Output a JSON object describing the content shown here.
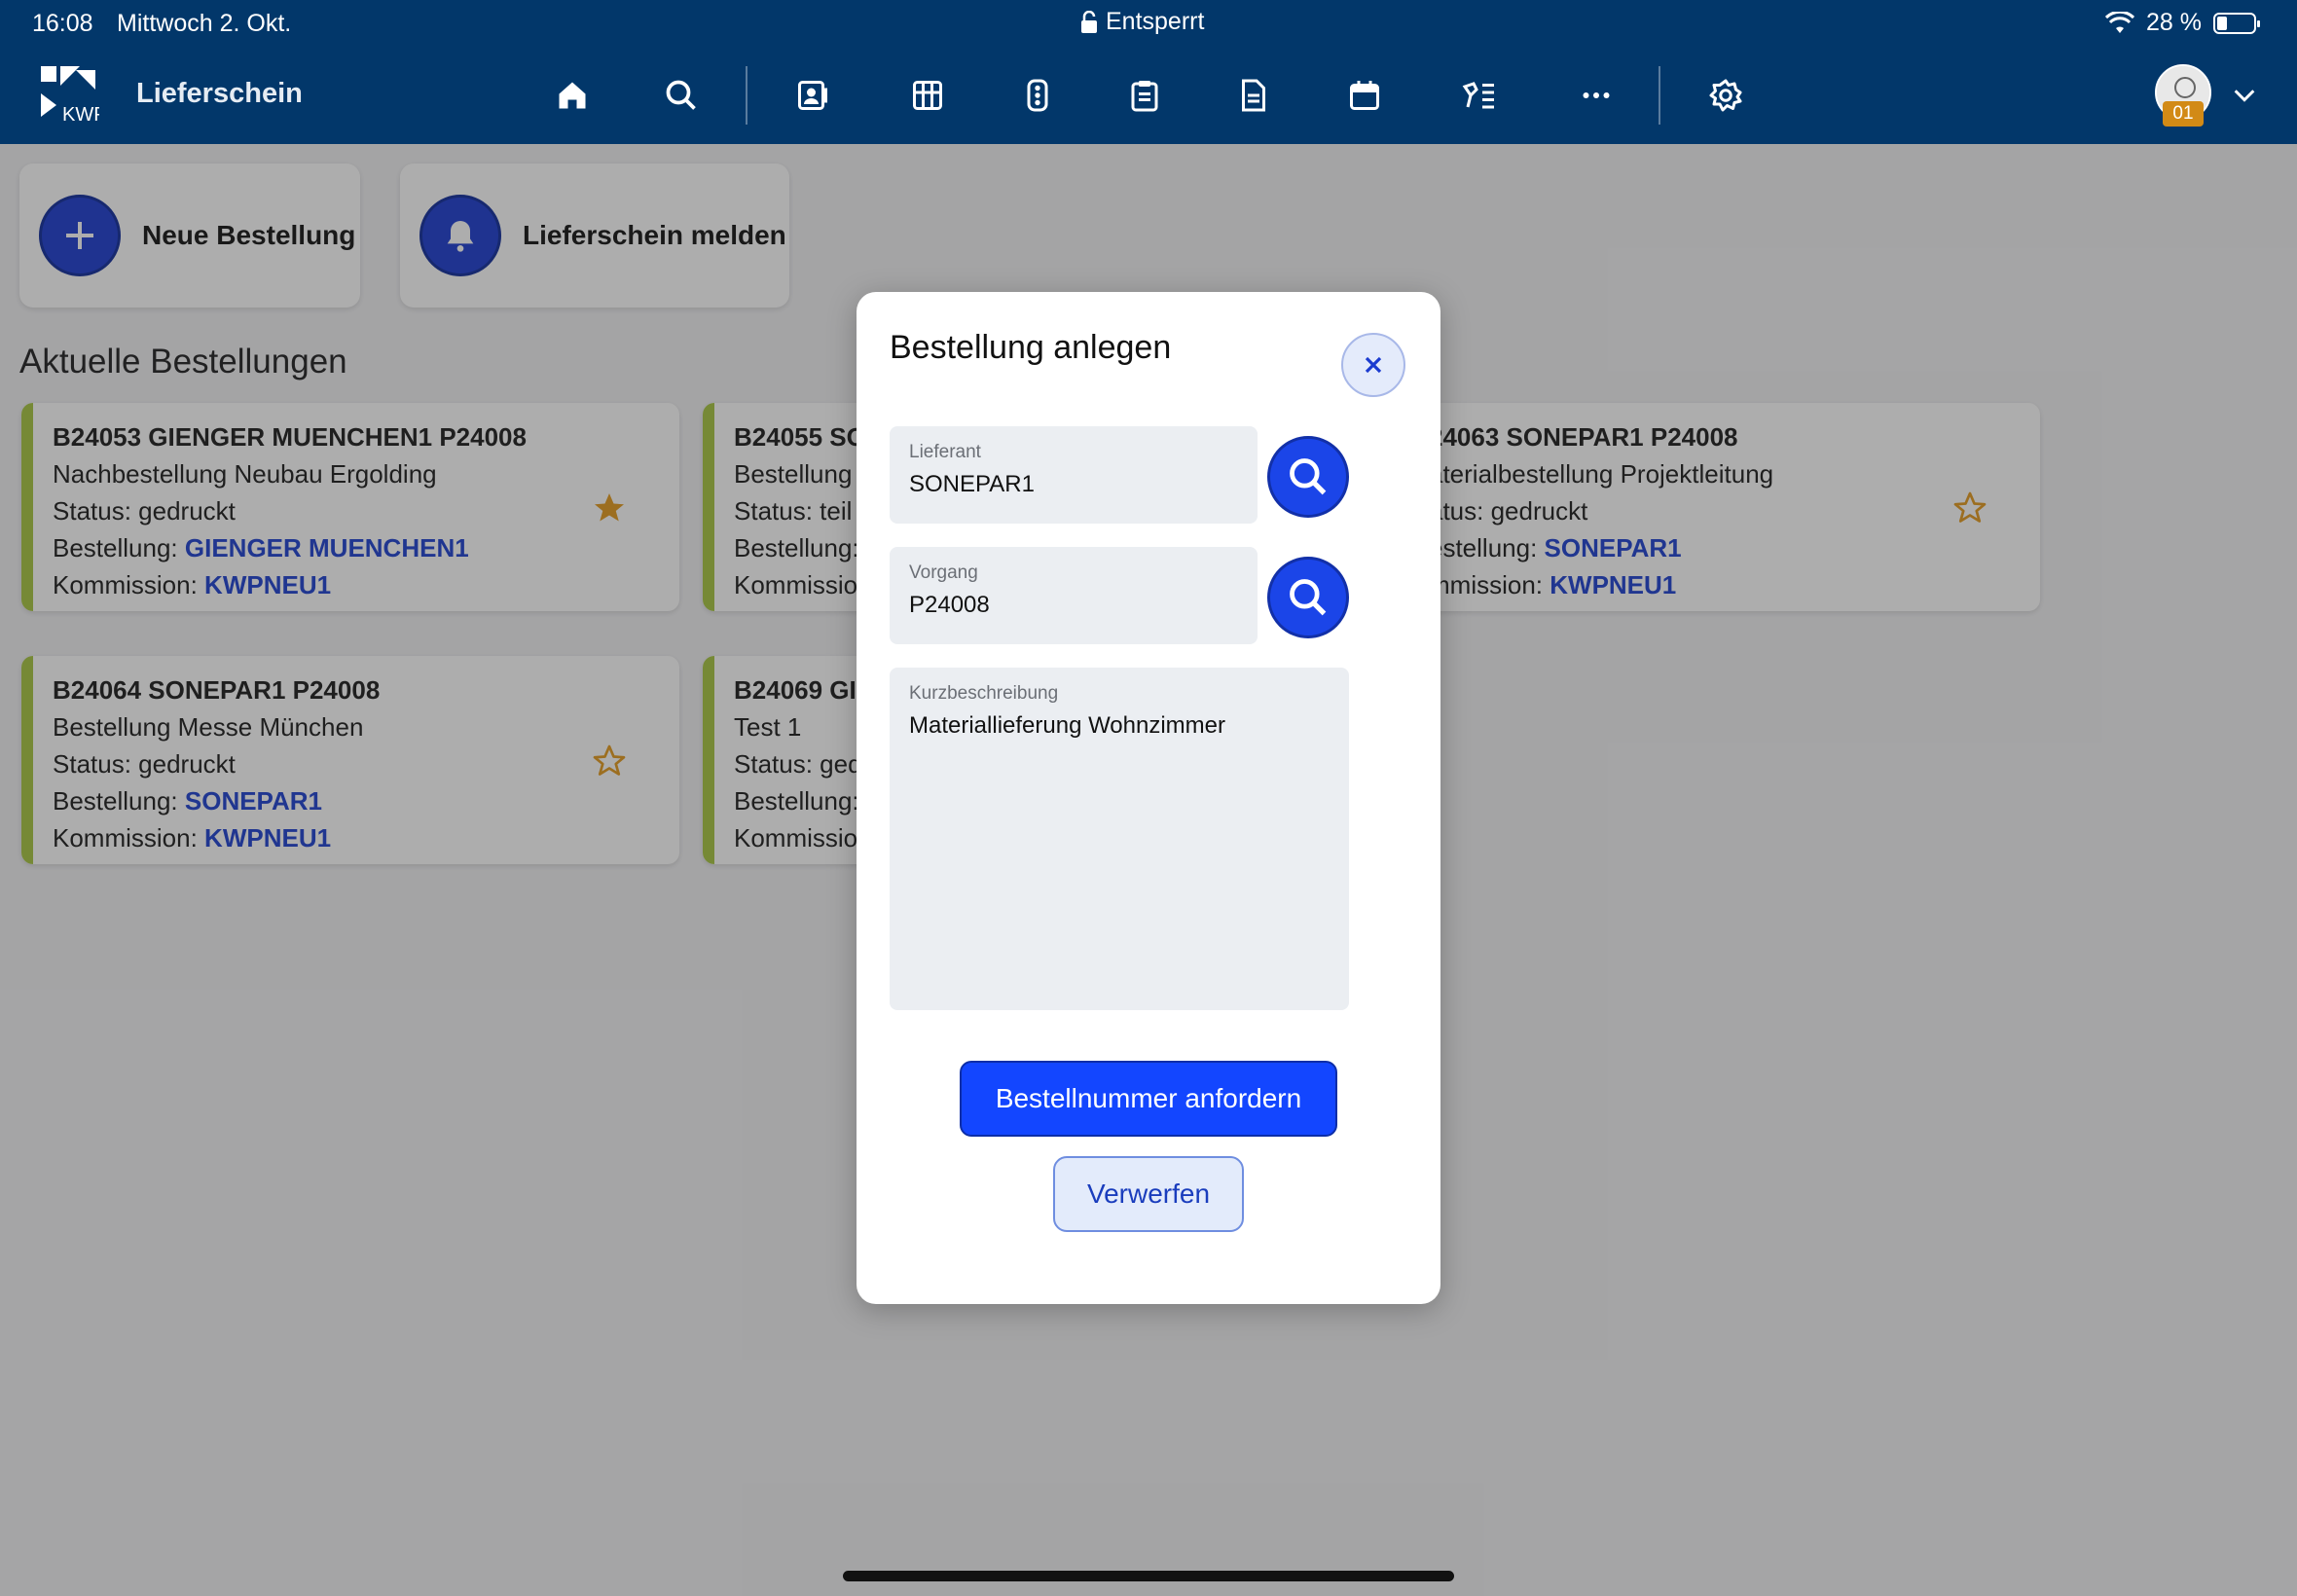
{
  "status_bar": {
    "time": "16:08",
    "date": "Mittwoch 2. Okt.",
    "lock_text": "Entsperrt",
    "battery": "28 %",
    "battery_level": 0.28
  },
  "header": {
    "title": "Lieferschein",
    "avatar_badge": "01",
    "nav_icons": [
      "home-icon",
      "search-icon",
      "contact-card-icon",
      "grid-icon",
      "traffic-light-icon",
      "clipboard-icon",
      "document-icon",
      "calendar-icon",
      "tools-list-icon",
      "more-icon",
      "settings-icon"
    ]
  },
  "actions": {
    "new_order": "Neue Bestellung",
    "report_delivery": "Lieferschein melden"
  },
  "section": {
    "title": "Aktuelle Bestellungen"
  },
  "orders": [
    {
      "title": "B24053 GIENGER MUENCHEN1 P24008",
      "description": "Nachbestellung Neubau Ergolding",
      "status": "Status: gedruckt",
      "order_label": "Bestellung: ",
      "order_value": "GIENGER MUENCHEN1",
      "commission_label": "Kommission: ",
      "commission_value": "KWPNEU1",
      "favorite": true
    },
    {
      "title": "B24055 SO",
      "description": "Bestellung",
      "status": "Status: teil",
      "order_label": "Bestellung:",
      "commission_label": "Kommissio"
    },
    {
      "title": "24063 SONEPAR1 P24008",
      "description": "aterialbestellung Projektleitung",
      "status": "atus: gedruckt",
      "order_label": "estellung: ",
      "order_value": "SONEPAR1",
      "commission_label": "mmission: ",
      "commission_value": "KWPNEU1",
      "favorite": false
    },
    {
      "title": "B24064 SONEPAR1 P24008",
      "description": "Bestellung Messe München",
      "status": "Status: gedruckt",
      "order_label": "Bestellung: ",
      "order_value": "SONEPAR1",
      "commission_label": "Kommission: ",
      "commission_value": "KWPNEU1",
      "favorite": false
    },
    {
      "title": "B24069 GII",
      "description": "Test 1",
      "status": "Status: ged",
      "order_label": "Bestellung:",
      "commission_label": "Kommissio"
    }
  ],
  "modal": {
    "title": "Bestellung anlegen",
    "supplier_label": "Lieferant",
    "supplier_value": "SONEPAR1",
    "process_label": "Vorgang",
    "process_value": "P24008",
    "description_label": "Kurzbeschreibung",
    "description_value": "Materiallieferung Wohnzimmer",
    "primary_button": "Bestellnummer anfordern",
    "secondary_button": "Verwerfen"
  },
  "colors": {
    "header_bg": "#02376a",
    "accent_blue": "#1346ff",
    "link_blue": "#1c3fd1",
    "card_accent": "#a6c63f",
    "star_orange": "#e49a1c"
  }
}
